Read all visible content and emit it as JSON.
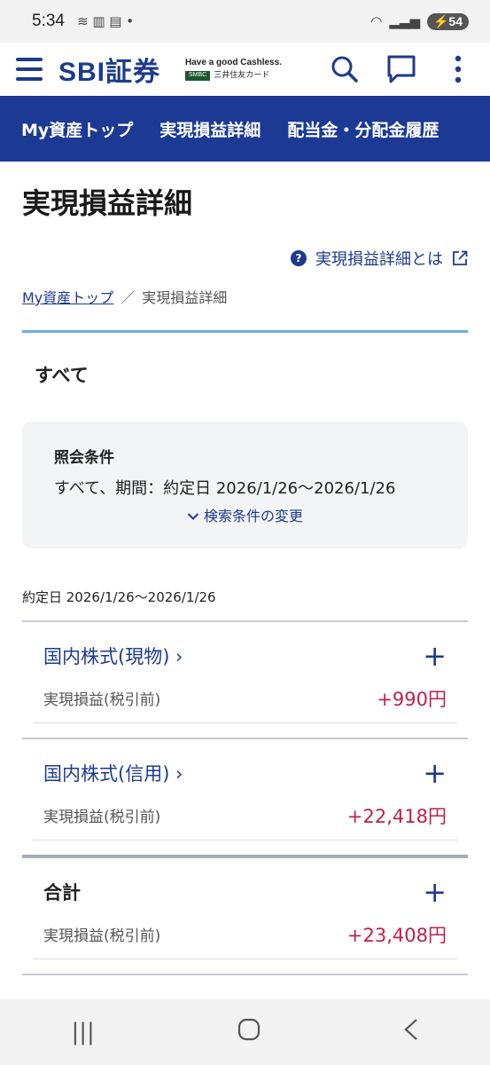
{
  "status": {
    "time": "5:34",
    "battery": "54"
  },
  "header": {
    "logo": "SBI証券",
    "tagline": "Have a good Cashless.",
    "smbc": "SMBC",
    "card_name": "三井住友カード"
  },
  "nav": {
    "tabs": [
      {
        "label": "My資産トップ"
      },
      {
        "label": "実現損益詳細"
      },
      {
        "label": "配当金・分配金履歴"
      }
    ]
  },
  "page": {
    "title": "実現損益詳細",
    "help_link": "実現損益詳細とは",
    "breadcrumb": {
      "home": "My資産トップ",
      "separator": "／",
      "current": "実現損益詳細"
    },
    "filter_label": "すべて",
    "condition": {
      "title": "照会条件",
      "text": "すべて、期間：約定日 2026/1/26〜2026/1/26",
      "change_link": "検索条件の変更"
    },
    "date_label": "約定日 2026/1/26〜2026/1/26",
    "cards": [
      {
        "title": "国内株式(現物) ›",
        "row_label": "実現損益(税引前)",
        "value": "+990円"
      },
      {
        "title": "国内株式(信用) ›",
        "row_label": "実現損益(税引前)",
        "value": "+22,418円"
      }
    ],
    "total": {
      "title": "合計",
      "row_label": "実現損益(税引前)",
      "value": "+23,408円"
    }
  },
  "colors": {
    "brand": "#1e3a8a",
    "nav_bg": "#1c3a94",
    "profit": "#c0204a",
    "accent_line": "#6aaede"
  }
}
